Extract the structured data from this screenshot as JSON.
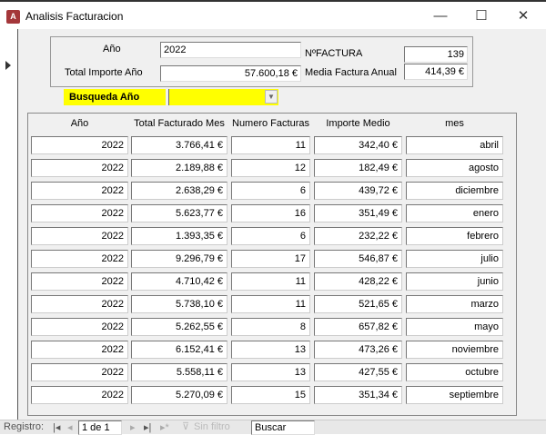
{
  "window": {
    "title": "Analisis Facturacion",
    "minimize": "—",
    "maximize": "☐",
    "close": "✕",
    "icon": "A"
  },
  "header": {
    "anio_label": "Año",
    "anio_value": "2022",
    "total_label": "Total Importe Año",
    "total_value": "57.600,18 €",
    "nfactura_label": "NºFACTURA",
    "nfactura_value": "139",
    "media_label": "Media Factura Anual",
    "media_value": "414,39 €"
  },
  "search": {
    "label": "Busqueda Año",
    "value": ""
  },
  "table": {
    "columns": [
      "Año",
      "Total Facturado Mes",
      "Numero Facturas",
      "Importe Medio",
      "mes"
    ],
    "rows": [
      [
        "2022",
        "3.766,41 €",
        "11",
        "342,40 €",
        "abril"
      ],
      [
        "2022",
        "2.189,88 €",
        "12",
        "182,49 €",
        "agosto"
      ],
      [
        "2022",
        "2.638,29 €",
        "6",
        "439,72 €",
        "diciembre"
      ],
      [
        "2022",
        "5.623,77 €",
        "16",
        "351,49 €",
        "enero"
      ],
      [
        "2022",
        "1.393,35 €",
        "6",
        "232,22 €",
        "febrero"
      ],
      [
        "2022",
        "9.296,79 €",
        "17",
        "546,87 €",
        "julio"
      ],
      [
        "2022",
        "4.710,42 €",
        "11",
        "428,22 €",
        "junio"
      ],
      [
        "2022",
        "5.738,10 €",
        "11",
        "521,65 €",
        "marzo"
      ],
      [
        "2022",
        "5.262,55 €",
        "8",
        "657,82 €",
        "mayo"
      ],
      [
        "2022",
        "6.152,41 €",
        "13",
        "473,26 €",
        "noviembre"
      ],
      [
        "2022",
        "5.558,11 €",
        "13",
        "427,55 €",
        "octubre"
      ],
      [
        "2022",
        "5.270,09 €",
        "15",
        "351,34 €",
        "septiembre"
      ]
    ]
  },
  "nav": {
    "label": "Registro:",
    "record": "1 de 1",
    "filter": "Sin filtro",
    "search": "Buscar"
  }
}
